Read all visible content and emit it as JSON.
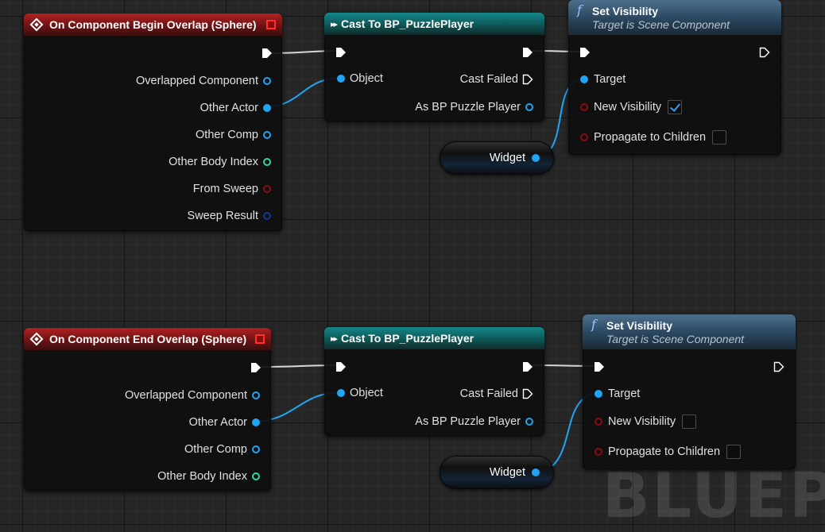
{
  "watermark": "BLUEPR",
  "colors": {
    "event_header": "#b22121",
    "cast_header": "#15888a",
    "function_header": "#4e6f8c",
    "object_pin": "#1fa5f3",
    "int_pin": "#2bd99e",
    "bool_pin": "#8a0d0d",
    "struct_pin": "#0f3a9a",
    "exec_pin": "#ffffff",
    "wire": "#1fa5f3"
  },
  "graph1": {
    "event": {
      "title": "On Component Begin Overlap (Sphere)",
      "pins": {
        "overlapped_component": "Overlapped Component",
        "other_actor": "Other Actor",
        "other_comp": "Other Comp",
        "other_body_index": "Other Body Index",
        "from_sweep": "From Sweep",
        "sweep_result": "Sweep Result"
      }
    },
    "cast": {
      "title": "Cast To BP_PuzzlePlayer",
      "object": "Object",
      "cast_failed": "Cast Failed",
      "as_player": "As BP Puzzle Player"
    },
    "set_visibility": {
      "title": "Set Visibility",
      "subtitle": "Target is Scene Component",
      "target": "Target",
      "new_visibility": "New Visibility",
      "new_visibility_checked": true,
      "propagate": "Propagate to Children",
      "propagate_checked": false
    },
    "widget": "Widget"
  },
  "graph2": {
    "event": {
      "title": "On Component End Overlap (Sphere)",
      "pins": {
        "overlapped_component": "Overlapped Component",
        "other_actor": "Other Actor",
        "other_comp": "Other Comp",
        "other_body_index": "Other Body Index"
      }
    },
    "cast": {
      "title": "Cast To BP_PuzzlePlayer",
      "object": "Object",
      "cast_failed": "Cast Failed",
      "as_player": "As BP Puzzle Player"
    },
    "set_visibility": {
      "title": "Set Visibility",
      "subtitle": "Target is Scene Component",
      "target": "Target",
      "new_visibility": "New Visibility",
      "new_visibility_checked": false,
      "propagate": "Propagate to Children",
      "propagate_checked": false
    },
    "widget": "Widget"
  }
}
